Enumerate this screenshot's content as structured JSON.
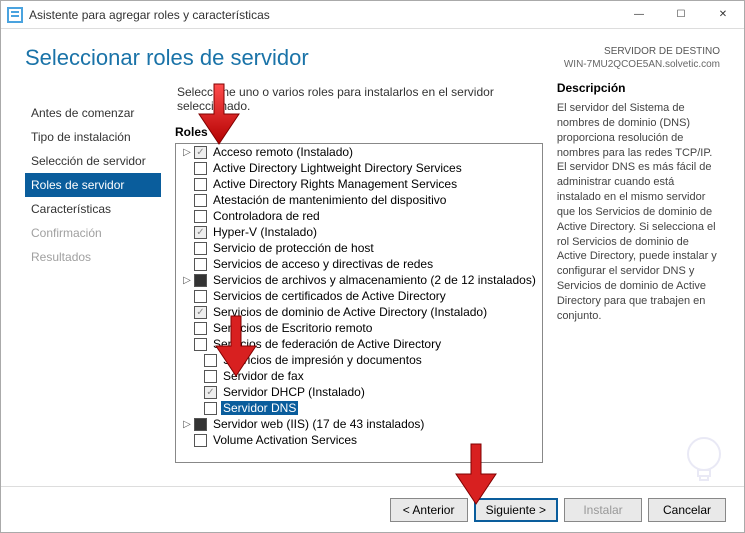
{
  "window": {
    "title": "Asistente para agregar roles y características"
  },
  "header": {
    "title": "Seleccionar roles de servidor",
    "dest_label": "SERVIDOR DE DESTINO",
    "dest_value": "WIN-7MU2QCOE5AN.solvetic.com"
  },
  "nav": {
    "items": [
      {
        "label": "Antes de comenzar",
        "state": "normal"
      },
      {
        "label": "Tipo de instalación",
        "state": "normal"
      },
      {
        "label": "Selección de servidor",
        "state": "normal"
      },
      {
        "label": "Roles de servidor",
        "state": "active"
      },
      {
        "label": "Características",
        "state": "normal"
      },
      {
        "label": "Confirmación",
        "state": "disabled"
      },
      {
        "label": "Resultados",
        "state": "disabled"
      }
    ]
  },
  "instruction": "Seleccione uno o varios roles para instalarlos en el servidor seleccionado.",
  "roles_label": "Roles",
  "roles": [
    {
      "label": "Acceso remoto (Instalado)",
      "checked": true,
      "dim": true,
      "expander": true
    },
    {
      "label": "Active Directory Lightweight Directory Services",
      "checked": false
    },
    {
      "label": "Active Directory Rights Management Services",
      "checked": false
    },
    {
      "label": "Atestación de mantenimiento del dispositivo",
      "checked": false
    },
    {
      "label": "Controladora de red",
      "checked": false
    },
    {
      "label": "Hyper-V (Instalado)",
      "checked": true,
      "dim": true
    },
    {
      "label": "Servicio de protección de host",
      "checked": false
    },
    {
      "label": "Servicios de acceso y directivas de redes",
      "checked": false
    },
    {
      "label": "Servicios de archivos y almacenamiento (2 de 12 instalados)",
      "filled": true,
      "expander": true
    },
    {
      "label": "Servicios de certificados de Active Directory",
      "checked": false
    },
    {
      "label": "Servicios de dominio de Active Directory (Instalado)",
      "checked": true,
      "dim": true
    },
    {
      "label": "Servicios de Escritorio remoto",
      "checked": false
    },
    {
      "label": "Servicios de federación de Active Directory",
      "checked": false
    },
    {
      "label": "Servicios de impresión y documentos",
      "checked": false,
      "indent": 1
    },
    {
      "label": "Servidor de fax",
      "checked": false,
      "indent": 1
    },
    {
      "label": "Servidor DHCP (Instalado)",
      "checked": true,
      "dim": true,
      "indent": 1
    },
    {
      "label": "Servidor DNS",
      "checked": false,
      "selected": true,
      "indent": 1
    },
    {
      "label": "Servidor web (IIS) (17 de 43 instalados)",
      "filled": true,
      "expander": true
    },
    {
      "label": "Volume Activation Services",
      "checked": false
    }
  ],
  "desc_label": "Descripción",
  "desc_text": "El servidor del Sistema de nombres de dominio (DNS) proporciona resolución de nombres para las redes TCP/IP. El servidor DNS es más fácil de administrar cuando está instalado en el mismo servidor que los Servicios de dominio de Active Directory. Si selecciona el rol Servicios de dominio de Active Directory, puede instalar y configurar el servidor DNS y Servicios de dominio de Active Directory para que trabajen en conjunto.",
  "buttons": {
    "prev": "< Anterior",
    "next": "Siguiente >",
    "install": "Instalar",
    "cancel": "Cancelar"
  }
}
